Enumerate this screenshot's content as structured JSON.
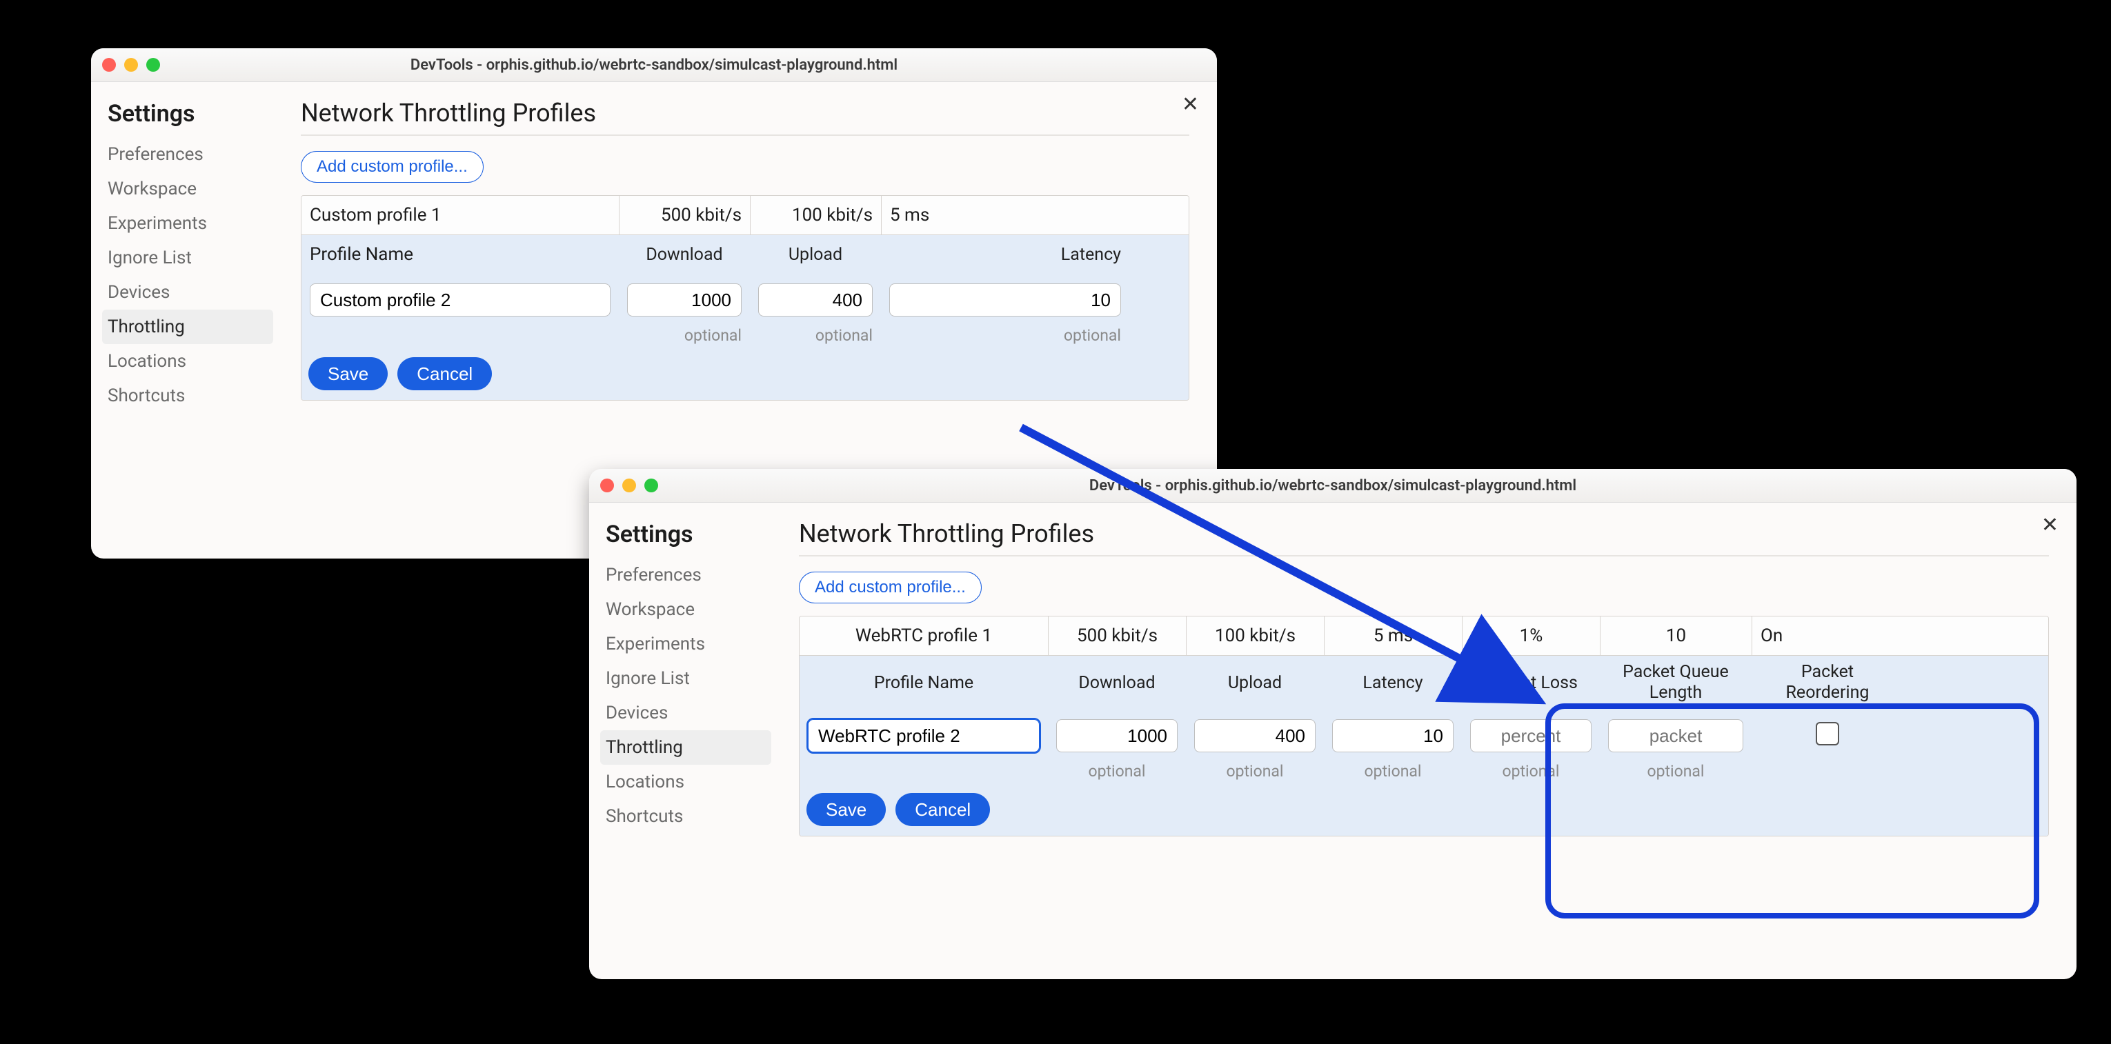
{
  "window_title": "DevTools - orphis.github.io/webrtc-sandbox/simulcast-playground.html",
  "settings_heading": "Settings",
  "nav": {
    "preferences": "Preferences",
    "workspace": "Workspace",
    "experiments": "Experiments",
    "ignore_list": "Ignore List",
    "devices": "Devices",
    "throttling": "Throttling",
    "locations": "Locations",
    "shortcuts": "Shortcuts"
  },
  "main_heading": "Network Throttling Profiles",
  "add_profile_label": "Add custom profile...",
  "columns": {
    "name": "Profile Name",
    "download": "Download",
    "upload": "Upload",
    "latency": "Latency",
    "packet_loss": "Packet Loss",
    "packet_queue": "Packet Queue Length",
    "packet_reorder": "Packet Reordering"
  },
  "hints": {
    "optional": "optional"
  },
  "placeholders": {
    "percent": "percent",
    "packet": "packet"
  },
  "buttons": {
    "save": "Save",
    "cancel": "Cancel"
  },
  "win1": {
    "existing": {
      "name": "Custom profile 1",
      "download": "500 kbit/s",
      "upload": "100 kbit/s",
      "latency": "5 ms"
    },
    "editing": {
      "name": "Custom profile 2",
      "download": "1000",
      "upload": "400",
      "latency": "10"
    }
  },
  "win2": {
    "existing": {
      "name": "WebRTC profile 1",
      "download": "500 kbit/s",
      "upload": "100 kbit/s",
      "latency": "5 ms",
      "packet_loss": "1%",
      "packet_queue": "10",
      "packet_reorder": "On"
    },
    "editing": {
      "name": "WebRTC profile 2",
      "download": "1000",
      "upload": "400",
      "latency": "10",
      "packet_loss": "",
      "packet_queue": "",
      "packet_reorder_checked": false
    }
  }
}
